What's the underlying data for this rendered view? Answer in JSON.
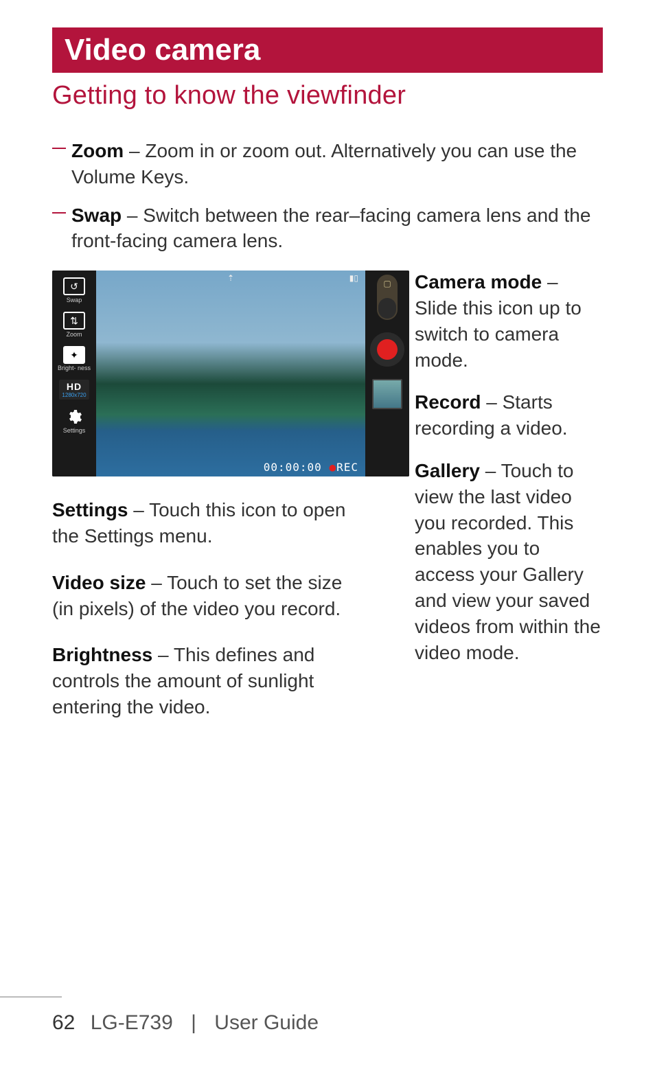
{
  "banner_title": "Video camera",
  "subtitle": "Getting to know the viewfinder",
  "callouts": {
    "zoom": {
      "term": "Zoom",
      "text": " – Zoom in or zoom out. Alternatively you can use the Volume Keys."
    },
    "swap": {
      "term": "Swap",
      "text": " – Switch between the rear–facing camera lens and the front-facing camera lens."
    },
    "settings": {
      "term": "Settings",
      "text": " – Touch this icon to open the Settings menu."
    },
    "videosize": {
      "term": "Video size",
      "text": " – Touch to set the size (in pixels) of the video you record."
    },
    "brightness": {
      "term": "Brightness",
      "text": " – This defines and controls the amount of sunlight entering the video."
    },
    "cameramode": {
      "term": "Camera mode",
      "text": " – Slide this icon up to switch to camera mode."
    },
    "record": {
      "term": "Record",
      "text": " – Starts recording a video."
    },
    "gallery": {
      "term": "Gallery",
      "text": " – Touch to view the last video you recorded. This enables you to access your Gallery and view your saved videos from within the video mode."
    }
  },
  "viewfinder": {
    "left_labels": {
      "swap": "Swap",
      "zoom": "Zoom",
      "brightness": "Bright-\nness",
      "settings": "Settings"
    },
    "hd_big": "HD",
    "hd_small": "1280x720",
    "timer": "00:00:00",
    "rec_label": "REC"
  },
  "footer": {
    "page": "62",
    "model": "LG-E739",
    "guide": "User Guide"
  }
}
